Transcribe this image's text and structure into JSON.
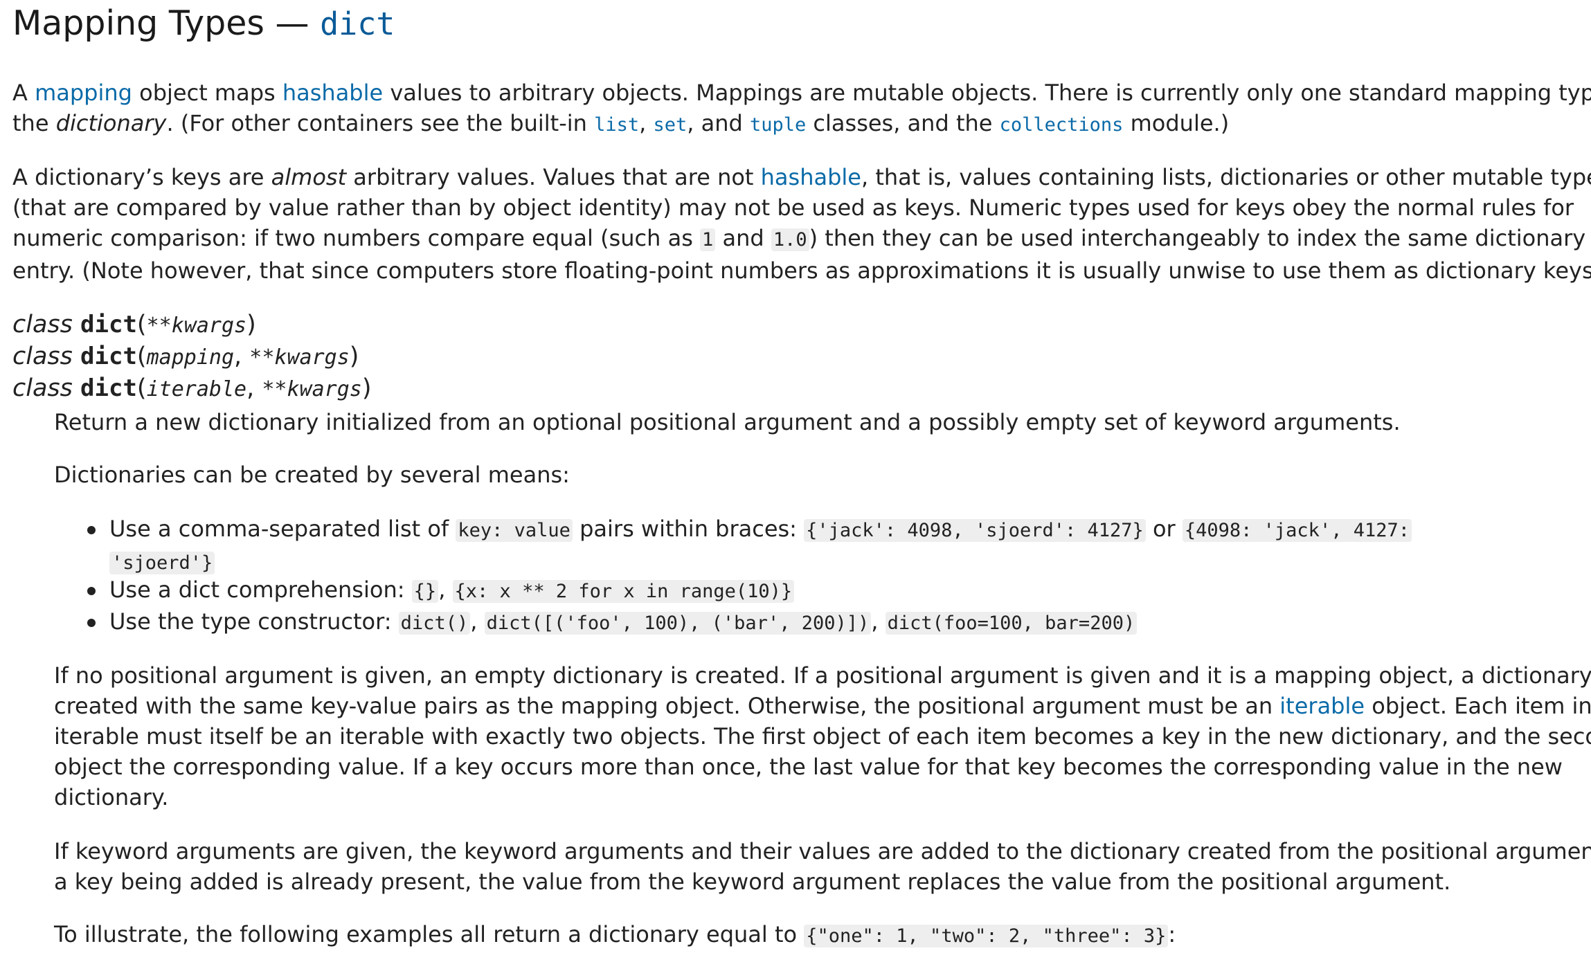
{
  "heading": {
    "text": "Mapping Types — ",
    "code": "dict"
  },
  "p1": {
    "l1": {
      "a": "A ",
      "link1": "mapping",
      "b": " object maps ",
      "link2": "hashable",
      "c": " values to arbitrary objects. Mappings are mutable objects. There is currently only one standard mapping type,"
    },
    "l2": {
      "a": "the ",
      "em": "dictionary",
      "b": ". (For other containers see the built-in ",
      "c1": "list",
      "s1": ", ",
      "c2": "set",
      "s2": ", and ",
      "c3": "tuple",
      "s3": " classes, and the ",
      "c4": "collections",
      "s4": " module.)"
    }
  },
  "p2": {
    "l1": {
      "a": "A dictionary’s keys are ",
      "em": "almost",
      "b": " arbitrary values. Values that are not ",
      "link": "hashable",
      "c": ", that is, values containing lists, dictionaries or other mutable types"
    },
    "l2": "(that are compared by value rather than by object identity) may not be used as keys. Numeric types used for keys obey the normal rules for",
    "l3": {
      "a": "numeric comparison: if two numbers compare equal (such as ",
      "c1": "1",
      "b": " and ",
      "c2": "1.0",
      "c": ") then they can be used interchangeably to index the same dictionary"
    },
    "l4": "entry. (Note however, that since computers store floating-point numbers as approximations it is usually unwise to use them as dictionary keys.)"
  },
  "signatures": [
    {
      "kw": "class",
      "name": "dict",
      "open": "(",
      "args": "**kwargs",
      "close": ")"
    },
    {
      "kw": "class",
      "name": "dict",
      "open": "(",
      "arg1": "mapping",
      "sep": ", ",
      "arg2": "**kwargs",
      "close": ")"
    },
    {
      "kw": "class",
      "name": "dict",
      "open": "(",
      "arg1": "iterable",
      "sep": ", ",
      "arg2": "**kwargs",
      "close": ")"
    }
  ],
  "desc1": "Return a new dictionary initialized from an optional positional argument and a possibly empty set of keyword arguments.",
  "desc2": "Dictionaries can be created by several means:",
  "bullets": {
    "b1": {
      "a": "Use a comma-separated list of ",
      "c1": "key: value",
      "b": " pairs within braces: ",
      "c2": "{'jack': 4098, 'sjoerd': 4127}",
      "c": " or ",
      "c3": "{4098: 'jack', 4127:",
      "c4": "'sjoerd'}"
    },
    "b2": {
      "a": "Use a dict comprehension: ",
      "c1": "{}",
      "s": ", ",
      "c2": "{x: x ** 2 for x in range(10)}"
    },
    "b3": {
      "a": "Use the type constructor: ",
      "c1": "dict()",
      "s1": ", ",
      "c2": "dict([('foo', 100), ('bar', 200)])",
      "s2": ", ",
      "c3": "dict(foo=100, bar=200)"
    }
  },
  "p3": {
    "l1": "If no positional argument is given, an empty dictionary is created. If a positional argument is given and it is a mapping object, a dictionary is",
    "l2": {
      "a": "created with the same key-value pairs as the mapping object. Otherwise, the positional argument must be an ",
      "link": "iterable",
      "b": " object. Each item in the"
    },
    "l3": "iterable must itself be an iterable with exactly two objects. The first object of each item becomes a key in the new dictionary, and the second",
    "l4": "object the corresponding value. If a key occurs more than once, the last value for that key becomes the corresponding value in the new",
    "l5": "dictionary."
  },
  "p4": {
    "l1": "If keyword arguments are given, the keyword arguments and their values are added to the dictionary created from the positional argument. If",
    "l2": "a key being added is already present, the value from the keyword argument replaces the value from the positional argument."
  },
  "p5": {
    "a": "To illustrate, the following examples all return a dictionary equal to ",
    "c": "{\"one\": 1, \"two\": 2, \"three\": 3}",
    "b": ":"
  }
}
